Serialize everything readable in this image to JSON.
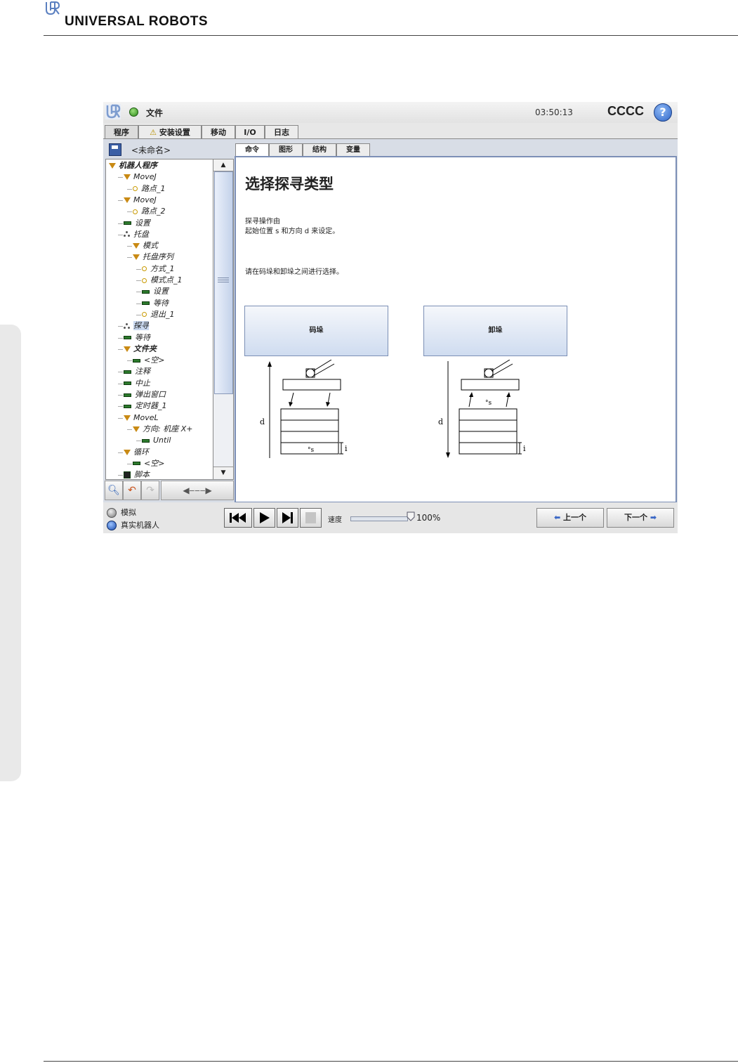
{
  "page": {
    "brand": "UNIVERSAL ROBOTS"
  },
  "titlebar": {
    "file_label": "文件",
    "time": "03:50:13",
    "robot_name": "CCCC",
    "help": "?"
  },
  "main_tabs": [
    {
      "label": "程序",
      "active": true
    },
    {
      "label": "安装设置",
      "warning": true
    },
    {
      "label": "移动"
    },
    {
      "label": "I/O"
    },
    {
      "label": "日志"
    }
  ],
  "program": {
    "name": "<未命名>",
    "tree": [
      {
        "label": "机器人程序",
        "icon": "triangle",
        "depth": 0,
        "bold": true
      },
      {
        "label": "MoveJ",
        "icon": "triangle",
        "depth": 1
      },
      {
        "label": "路点_1",
        "icon": "dot",
        "depth": 2
      },
      {
        "label": "MoveJ",
        "icon": "triangle",
        "depth": 1
      },
      {
        "label": "路点_2",
        "icon": "dot",
        "depth": 2
      },
      {
        "label": "设置",
        "icon": "bar",
        "depth": 1
      },
      {
        "label": "托盘",
        "icon": "three",
        "depth": 1
      },
      {
        "label": "模式",
        "icon": "triangle",
        "depth": 2
      },
      {
        "label": "托盘序列",
        "icon": "triangle",
        "depth": 2
      },
      {
        "label": "方式_1",
        "icon": "dot",
        "depth": 3
      },
      {
        "label": "模式点_1",
        "icon": "dot",
        "depth": 3
      },
      {
        "label": "设置",
        "icon": "bar",
        "depth": 3
      },
      {
        "label": "等待",
        "icon": "bar",
        "depth": 3
      },
      {
        "label": "退出_1",
        "icon": "dot",
        "depth": 3
      },
      {
        "label": "探寻",
        "icon": "three",
        "depth": 1,
        "selected": true
      },
      {
        "label": "等待",
        "icon": "bar",
        "depth": 1
      },
      {
        "label": "文件夹",
        "icon": "triangle",
        "depth": 1,
        "bold": true
      },
      {
        "label": "<空>",
        "icon": "bar",
        "depth": 2
      },
      {
        "label": "注释",
        "icon": "bar",
        "depth": 1
      },
      {
        "label": "中止",
        "icon": "bar",
        "depth": 1
      },
      {
        "label": "弹出窗口",
        "icon": "bar",
        "depth": 1
      },
      {
        "label": "定时器_1",
        "icon": "bar",
        "depth": 1
      },
      {
        "label": "MoveL",
        "icon": "triangle",
        "depth": 1
      },
      {
        "label": "方向: 机座 X+",
        "icon": "triangle",
        "depth": 2
      },
      {
        "label": "Until",
        "icon": "bar",
        "depth": 3
      },
      {
        "label": "循环",
        "icon": "triangle",
        "depth": 1
      },
      {
        "label": "<空>",
        "icon": "bar",
        "depth": 2
      },
      {
        "label": "脚本",
        "icon": "script",
        "depth": 1
      }
    ]
  },
  "sub_tabs": [
    {
      "label": "命令",
      "active": true
    },
    {
      "label": "图形"
    },
    {
      "label": "结构"
    },
    {
      "label": "变量"
    }
  ],
  "content": {
    "title": "选择探寻类型",
    "desc_line1": "探寻操作由",
    "desc_line2": "起始位置 s 和方向 d 来设定。",
    "instruction": "请在码垛和卸垛之间进行选择。",
    "stack_button": "码垛",
    "destack_button": "卸垛",
    "diagram_d": "d",
    "diagram_s": "°s",
    "diagram_i": "i"
  },
  "bottom": {
    "simulate_label": "模拟",
    "real_robot_label": "真实机器人",
    "speed_label": "速度",
    "speed_value": "100%",
    "speed_fraction": 1.0,
    "prev_label": "上一个",
    "next_label": "下一个"
  }
}
